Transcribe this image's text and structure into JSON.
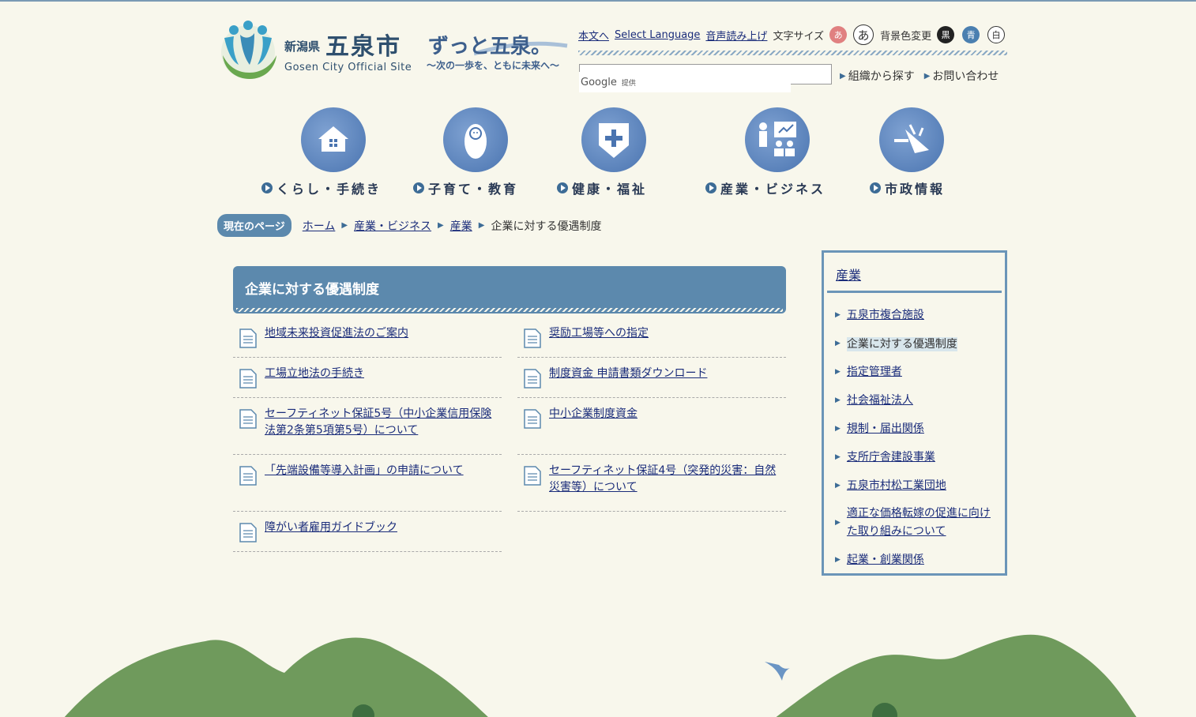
{
  "logo": {
    "pref": "新潟県",
    "city": "五泉市",
    "en": "Gosen City Official Site"
  },
  "slogan": {
    "main": "ずっと五泉。",
    "sub": "〜次の一歩を、ともに未来へ〜"
  },
  "util": {
    "honbun": "本文へ",
    "language": "Select Language",
    "voice": "音声読み上げ",
    "font_size_label": "文字サイズ",
    "font_small": "あ",
    "font_large": "あ",
    "bg_label": "背景色変更",
    "bg_black": "黒",
    "bg_blue": "青",
    "bg_white": "白"
  },
  "search": {
    "google": "Google",
    "provided": "提供"
  },
  "header_links": {
    "org": "組織から探す",
    "contact": "お問い合わせ"
  },
  "nav": [
    {
      "label": "くらし・手続き",
      "icon": "house-icon"
    },
    {
      "label": "子育て・教育",
      "icon": "baby-icon"
    },
    {
      "label": "健康・福祉",
      "icon": "health-cross-icon"
    },
    {
      "label": "産業・ビジネス",
      "icon": "business-presentation-icon"
    },
    {
      "label": "市政情報",
      "icon": "megaphone-icon"
    }
  ],
  "breadcrumb": {
    "badge": "現在のページ",
    "items": [
      "ホーム",
      "産業・ビジネス",
      "産業"
    ],
    "current": "企業に対する優遇制度"
  },
  "page_title": "企業に対する優遇制度",
  "links": [
    [
      "地域未来投資促進法のご案内",
      "奨励工場等への指定"
    ],
    [
      "工場立地法の手続き",
      "制度資金 申請書類ダウンロード"
    ],
    [
      "セーフティネット保証5号（中小企業信用保険法第2条第5項第5号）について",
      "中小企業制度資金"
    ],
    [
      "「先端設備等導入計画」の申請について",
      "セーフティネット保証4号（突発的災害：自然災害等）について"
    ],
    [
      "障がい者雇用ガイドブック",
      ""
    ]
  ],
  "side": {
    "title": "産業",
    "items": [
      "五泉市複合施設",
      "企業に対する優遇制度",
      "指定管理者",
      "社会福祉法人",
      "規制・届出関係",
      "支所庁舎建設事業",
      "五泉市村松工業団地",
      "適正な価格転嫁の促進に向けた取り組みについて",
      "起業・創業関係"
    ],
    "current_index": 1
  },
  "colors": {
    "accent": "#5c89ad",
    "link": "#1a2c7a",
    "background": "#f8f7ec",
    "hill": "#6f9a5c"
  }
}
